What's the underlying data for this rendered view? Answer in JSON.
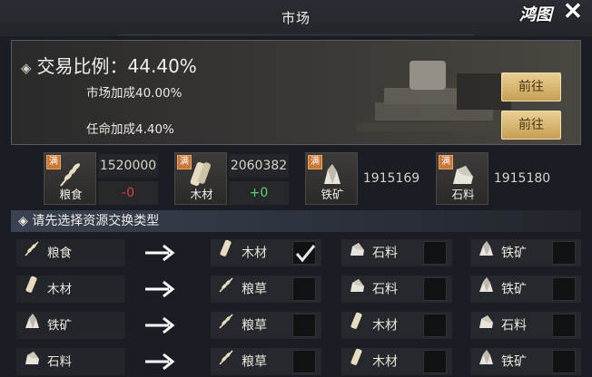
{
  "header": {
    "title": "市场",
    "logo_text": "鸿图"
  },
  "ratio": {
    "label": "交易比例：44.40%",
    "market_bonus": "市场加成40.00%",
    "appoint_bonus": "任命加成4.40%",
    "go_button": "前往"
  },
  "resources": [
    {
      "name": "粮食",
      "amount": "1520000",
      "delta": "-0",
      "delta_color": "#e0423a",
      "badge": "满",
      "icon": "grain-icon"
    },
    {
      "name": "木材",
      "amount": "2060382",
      "delta": "+0",
      "delta_color": "#5fd16a",
      "badge": "满",
      "icon": "wood-icon"
    },
    {
      "name": "铁矿",
      "amount": "1915169",
      "delta": "",
      "badge": "满",
      "icon": "ore-icon"
    },
    {
      "name": "石料",
      "amount": "1915180",
      "delta": "",
      "badge": "满",
      "icon": "stone-icon"
    }
  ],
  "section_title": "请先选择资源交换类型",
  "exchange_rows": [
    {
      "source": "粮食",
      "options": [
        {
          "label": "木材",
          "checked": true
        },
        {
          "label": "石料",
          "checked": false
        },
        {
          "label": "铁矿",
          "checked": false
        }
      ]
    },
    {
      "source": "木材",
      "options": [
        {
          "label": "粮草",
          "checked": false
        },
        {
          "label": "石料",
          "checked": false
        },
        {
          "label": "铁矿",
          "checked": false
        }
      ]
    },
    {
      "source": "铁矿",
      "options": [
        {
          "label": "粮草",
          "checked": false
        },
        {
          "label": "木材",
          "checked": false
        },
        {
          "label": "石料",
          "checked": false
        }
      ]
    },
    {
      "source": "石料",
      "options": [
        {
          "label": "粮草",
          "checked": false
        },
        {
          "label": "木材",
          "checked": false
        },
        {
          "label": "铁矿",
          "checked": false
        }
      ]
    }
  ]
}
